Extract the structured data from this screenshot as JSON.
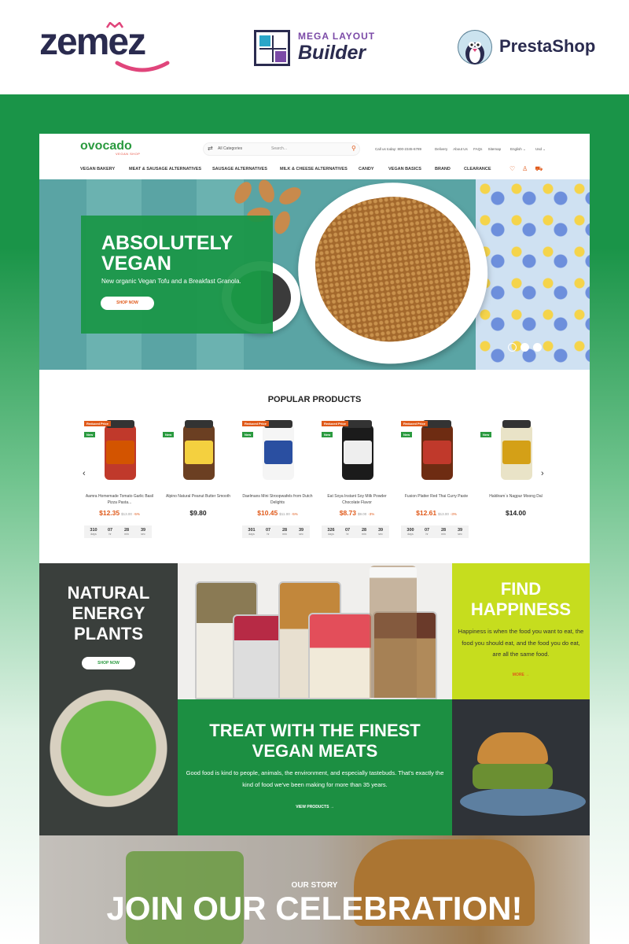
{
  "brands": {
    "zemez": "zemez",
    "mega_top": "MEGA LAYOUT",
    "mega_bottom": "Builder",
    "presta": "PrestaShop"
  },
  "colors": {
    "green": "#1a9448",
    "orange": "#e05a1a",
    "lime": "#c6dd1e",
    "navy": "#2a2b4f"
  },
  "header": {
    "logo": "ovocado",
    "logo_sub": "VEGAN SHOP",
    "category_select": "All Categories",
    "search_placeholder": "Search...",
    "call": "Call us today: 800-2345-6789",
    "links": [
      "Delivery",
      "About Us",
      "FAQs",
      "Sitemap"
    ],
    "language": "English",
    "currency": "Usd"
  },
  "nav": [
    "VEGAN BAKERY",
    "MEAT & SAUSAGE ALTERNATIVES",
    "SAUSAGE ALTERNATIVES",
    "MILK & CHEESE ALTERNATIVES",
    "CANDY",
    "VEGAN BASICS",
    "BRAND",
    "CLEARANCE"
  ],
  "icons": [
    "heart-icon",
    "user-icon",
    "cart-icon"
  ],
  "hero": {
    "title": "ABSOLUTELY VEGAN",
    "subtitle": "New organic Vegan Tofu and a Breakfast Granola.",
    "button": "SHOP NOW"
  },
  "popular": {
    "title": "POPULAR PRODUCTS",
    "products": [
      {
        "name": "Aamra Homemade Tomato Garlic Basil Pizza Pasta...",
        "price": "$12.35",
        "old": "$13.00",
        "disc": "-5%",
        "badges": [
          "Reduced Price",
          "New"
        ],
        "countdown": [
          "310",
          "07",
          "28",
          "39"
        ]
      },
      {
        "name": "Alpino Natural Peanut Butter Smooth",
        "price": "$9.80",
        "old": "",
        "disc": "",
        "badges": [
          "New"
        ],
        "countdown": []
      },
      {
        "name": "Daelmans Mini Stroopwafels from Dutch Delights",
        "price": "$10.45",
        "old": "$11.00",
        "disc": "-5%",
        "badges": [
          "Reduced Price",
          "New"
        ],
        "countdown": [
          "301",
          "07",
          "28",
          "39"
        ]
      },
      {
        "name": "Eat Soya Instant Soy Milk Powder Chocolate Flavor",
        "price": "$8.73",
        "old": "$9.00",
        "disc": "-3%",
        "badges": [
          "Reduced Price",
          "New"
        ],
        "countdown": [
          "326",
          "07",
          "28",
          "39"
        ]
      },
      {
        "name": "Fusion Platter Red Thai Curry Paste",
        "price": "$12.61",
        "old": "$13.00",
        "disc": "-3%",
        "badges": [
          "Reduced Price",
          "New"
        ],
        "countdown": [
          "300",
          "07",
          "28",
          "39"
        ]
      },
      {
        "name": "Haldiram`s Nagpur Moong Dal",
        "price": "$14.00",
        "old": "",
        "disc": "",
        "badges": [
          "New"
        ],
        "countdown": []
      }
    ],
    "countdown_units": [
      "days",
      "hr",
      "min",
      "sec"
    ]
  },
  "tiles": {
    "natural": {
      "title": "NATURAL ENERGY PLANTS",
      "button": "SHOP NOW"
    },
    "find": {
      "title": "FIND HAPPINESS",
      "text": "Happiness is when the food you want to eat, the food you should eat, and the food you do eat, are all the same food.",
      "more": "MORE →"
    },
    "treat": {
      "title": "TREAT WITH THE FINEST VEGAN MEATS",
      "text": "Good food is kind to people, animals, the environment, and especially tastebuds. That's exactly the kind of food we've been making for more than 35 years.",
      "more": "VIEW PRODUCTS →"
    }
  },
  "story": {
    "kicker": "OUR STORY",
    "title": "JOIN OUR CELEBRATION!"
  }
}
